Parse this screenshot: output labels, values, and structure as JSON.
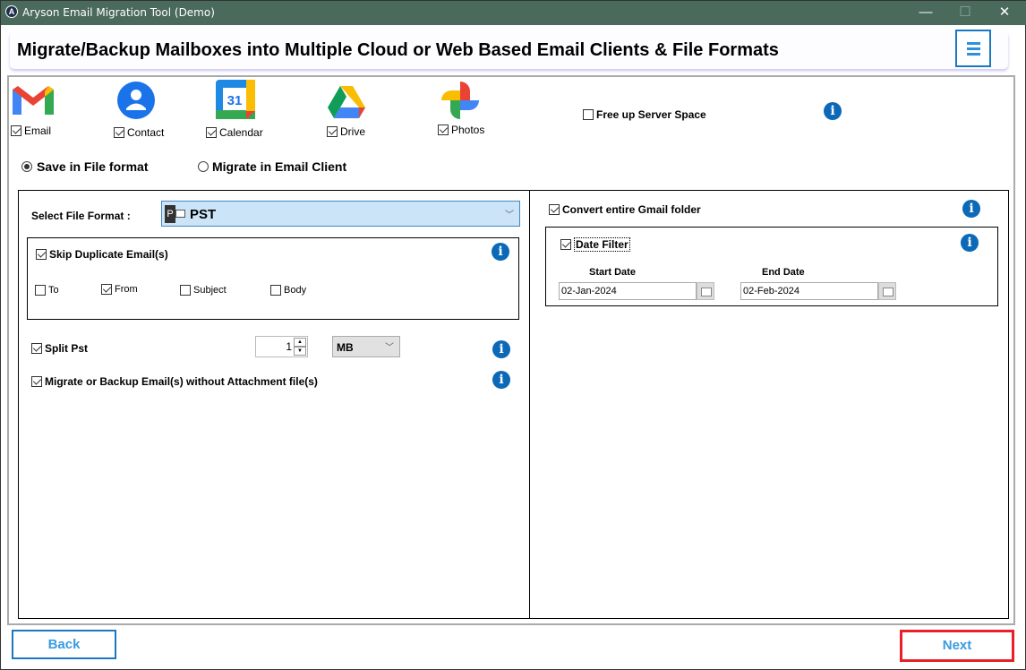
{
  "window": {
    "title": "Aryson Email Migration Tool (Demo)",
    "logo": "A",
    "controls": {
      "minimize": "—",
      "maximize": "☐",
      "close": "✕"
    }
  },
  "header": {
    "title": "Migrate/Backup Mailboxes into Multiple Cloud or Web Based Email Clients & File Formats",
    "menu_icon": "hamburger-icon"
  },
  "services": [
    {
      "label": "Email",
      "checked": true,
      "icon": "gmail-icon"
    },
    {
      "label": "Contact",
      "checked": true,
      "icon": "contacts-icon"
    },
    {
      "label": "Calendar",
      "checked": true,
      "icon": "calendar-icon",
      "icon_text": "31"
    },
    {
      "label": "Drive",
      "checked": true,
      "icon": "drive-icon"
    },
    {
      "label": "Photos",
      "checked": true,
      "icon": "photos-icon"
    }
  ],
  "free_up": {
    "label": "Free up Server Space",
    "checked": false
  },
  "mode": {
    "options": [
      "Save in File format",
      "Migrate in Email Client"
    ],
    "selected": "Save in File format"
  },
  "left": {
    "format_label": "Select File Format :",
    "format_value": "PST",
    "skip_duplicate": {
      "label": "Skip Duplicate Email(s)",
      "checked": true,
      "fields": [
        {
          "label": "To",
          "checked": false
        },
        {
          "label": "From",
          "checked": true
        },
        {
          "label": "Subject",
          "checked": false
        },
        {
          "label": "Body",
          "checked": false
        }
      ]
    },
    "split": {
      "label": "Split Pst",
      "checked": true,
      "value": "1",
      "unit": "MB"
    },
    "no_attach": {
      "label": "Migrate or Backup Email(s) without Attachment file(s)",
      "checked": true
    }
  },
  "right": {
    "convert_all": {
      "label": "Convert entire Gmail folder",
      "checked": true
    },
    "date_filter": {
      "label": "Date Filter",
      "checked": true,
      "start_label": "Start Date",
      "start": "02-Jan-2024",
      "end_label": "End Date",
      "end": "02-Feb-2024"
    }
  },
  "footer": {
    "back": "Back",
    "next": "Next"
  },
  "colors": {
    "titlebar": "#4a6a5b",
    "accent": "#1a78c2",
    "info": "#0b69b7",
    "next_border": "#e8202a",
    "select_bg": "#cce4f7"
  }
}
